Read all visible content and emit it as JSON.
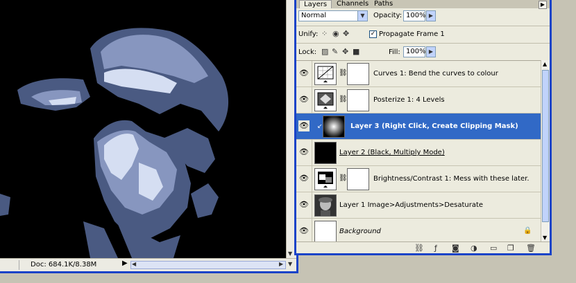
{
  "document": {
    "status_doc": "Doc: 684.1K/8.38M"
  },
  "palette": {
    "tabs": [
      "Layers",
      "Channels",
      "Paths"
    ],
    "blend_mode": "Normal",
    "opacity_label": "Opacity:",
    "opacity_value": "100%",
    "unify_label": "Unify:",
    "propagate_label": "Propagate Frame 1",
    "propagate_checked": true,
    "lock_label": "Lock:",
    "fill_label": "Fill:",
    "fill_value": "100%",
    "layers": [
      {
        "name": "Curves 1: Bend the curves to colour",
        "type": "adjustment-curves",
        "has_mask": true,
        "selected": false
      },
      {
        "name": "Posterize 1: 4 Levels",
        "type": "adjustment-posterize",
        "has_mask": true,
        "selected": false
      },
      {
        "name": "Layer 3 (Right Click, Create Clipping Mask)",
        "type": "gradient",
        "has_mask": false,
        "selected": true
      },
      {
        "name": "Layer 2 (Black, Multiply Mode)",
        "type": "black",
        "has_mask": false,
        "selected": false
      },
      {
        "name": "Brightness/Contrast 1: Mess with these later.",
        "type": "adjustment-brightness",
        "has_mask": true,
        "selected": false
      },
      {
        "name": "Layer 1 Image>Adjustments>Desaturate",
        "type": "photo",
        "has_mask": false,
        "selected": false
      },
      {
        "name": "Background",
        "type": "white",
        "has_mask": false,
        "selected": false
      }
    ]
  },
  "colors": {
    "selection": "#3169c6",
    "window_border": "#1a43c8",
    "poster_light": "#d5def2",
    "poster_mid": "#8796bf",
    "poster_dark": "#4a5a82"
  }
}
